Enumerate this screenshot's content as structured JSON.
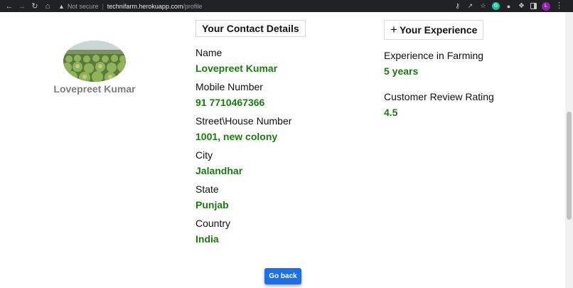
{
  "browser": {
    "security_label": "Not secure",
    "url_host": "technifarm.herokuapp.com",
    "url_path": "/profile",
    "profile_initial": "L"
  },
  "profile": {
    "name": "Lovepreet Kumar"
  },
  "contact": {
    "header": "Your Contact Details",
    "fields": [
      {
        "label": "Name",
        "value": "Lovepreet Kumar"
      },
      {
        "label": "Mobile Number",
        "value": "91 7710467366"
      },
      {
        "label": "Street\\House Number",
        "value": "1001, new colony"
      },
      {
        "label": "City",
        "value": "Jalandhar"
      },
      {
        "label": "State",
        "value": "Punjab"
      },
      {
        "label": "Country",
        "value": "India"
      }
    ]
  },
  "experience": {
    "header_icon": "+",
    "header": "Your Experience",
    "fields": [
      {
        "label": "Experience in Farming",
        "value": "5 years"
      },
      {
        "label": "Customer Review Rating",
        "value": "4.5"
      }
    ]
  },
  "actions": {
    "go_back_label": "Go back"
  },
  "colors": {
    "value_green": "#1b7a11",
    "button_blue": "#1b6fe8"
  }
}
